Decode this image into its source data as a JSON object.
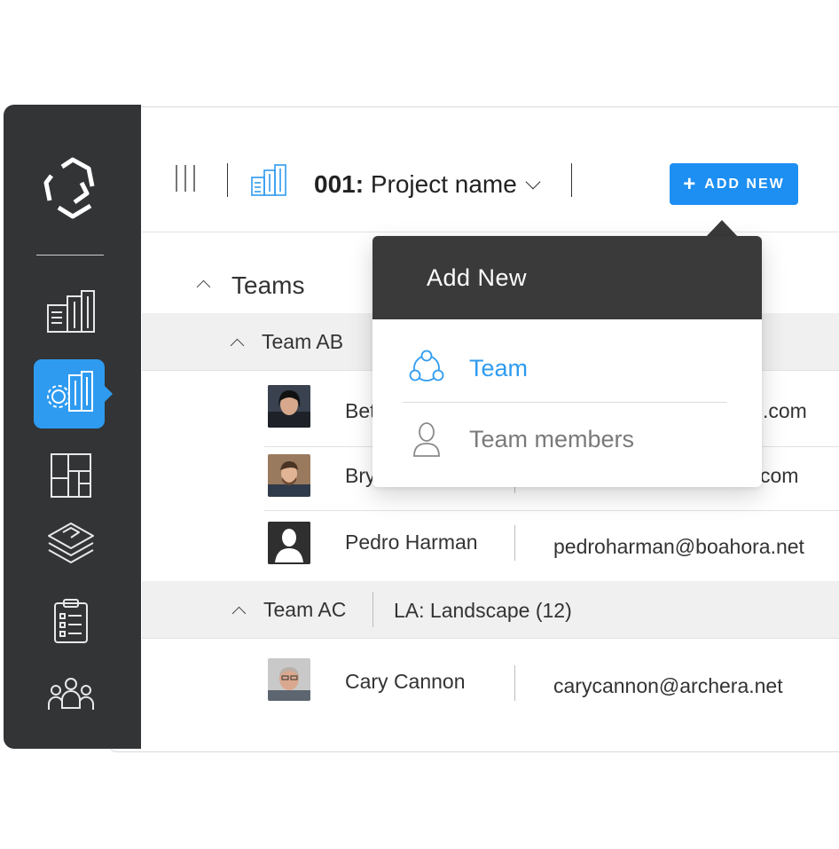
{
  "colors": {
    "accent": "#1d8ff2",
    "sidebar": "#333436",
    "menu_header": "#3b3a3a"
  },
  "sidebar": {
    "items": [
      {
        "icon": "buildings-icon"
      },
      {
        "icon": "building-settings-icon",
        "active": true
      },
      {
        "icon": "layout-grid-icon"
      },
      {
        "icon": "layers-icon"
      },
      {
        "icon": "checklist-icon"
      },
      {
        "icon": "people-group-icon"
      }
    ]
  },
  "header": {
    "project_number": "001:",
    "project_name": " Project name",
    "add_button_label": "ADD NEW",
    "add_button_icon": "plus-icon"
  },
  "content": {
    "section_title": "Teams",
    "groups": [
      {
        "name": "Team AB",
        "members": [
          {
            "name": "Bet",
            "email": ".com"
          },
          {
            "name": "Bry",
            "email": "com"
          },
          {
            "name": "Pedro Harman",
            "email": "pedroharman@boahora.net"
          }
        ]
      },
      {
        "name": "Team AC",
        "discipline": "LA: Landscape (12)",
        "members": [
          {
            "name": "Cary Cannon",
            "email": "carycannon@archera.net"
          }
        ]
      }
    ]
  },
  "dropdown": {
    "title": "Add New",
    "items": [
      {
        "label": "Team",
        "icon": "team-icon",
        "color": "#2e9bf0"
      },
      {
        "label": "Team members",
        "icon": "person-icon",
        "color": "#7a7a7a"
      }
    ]
  }
}
